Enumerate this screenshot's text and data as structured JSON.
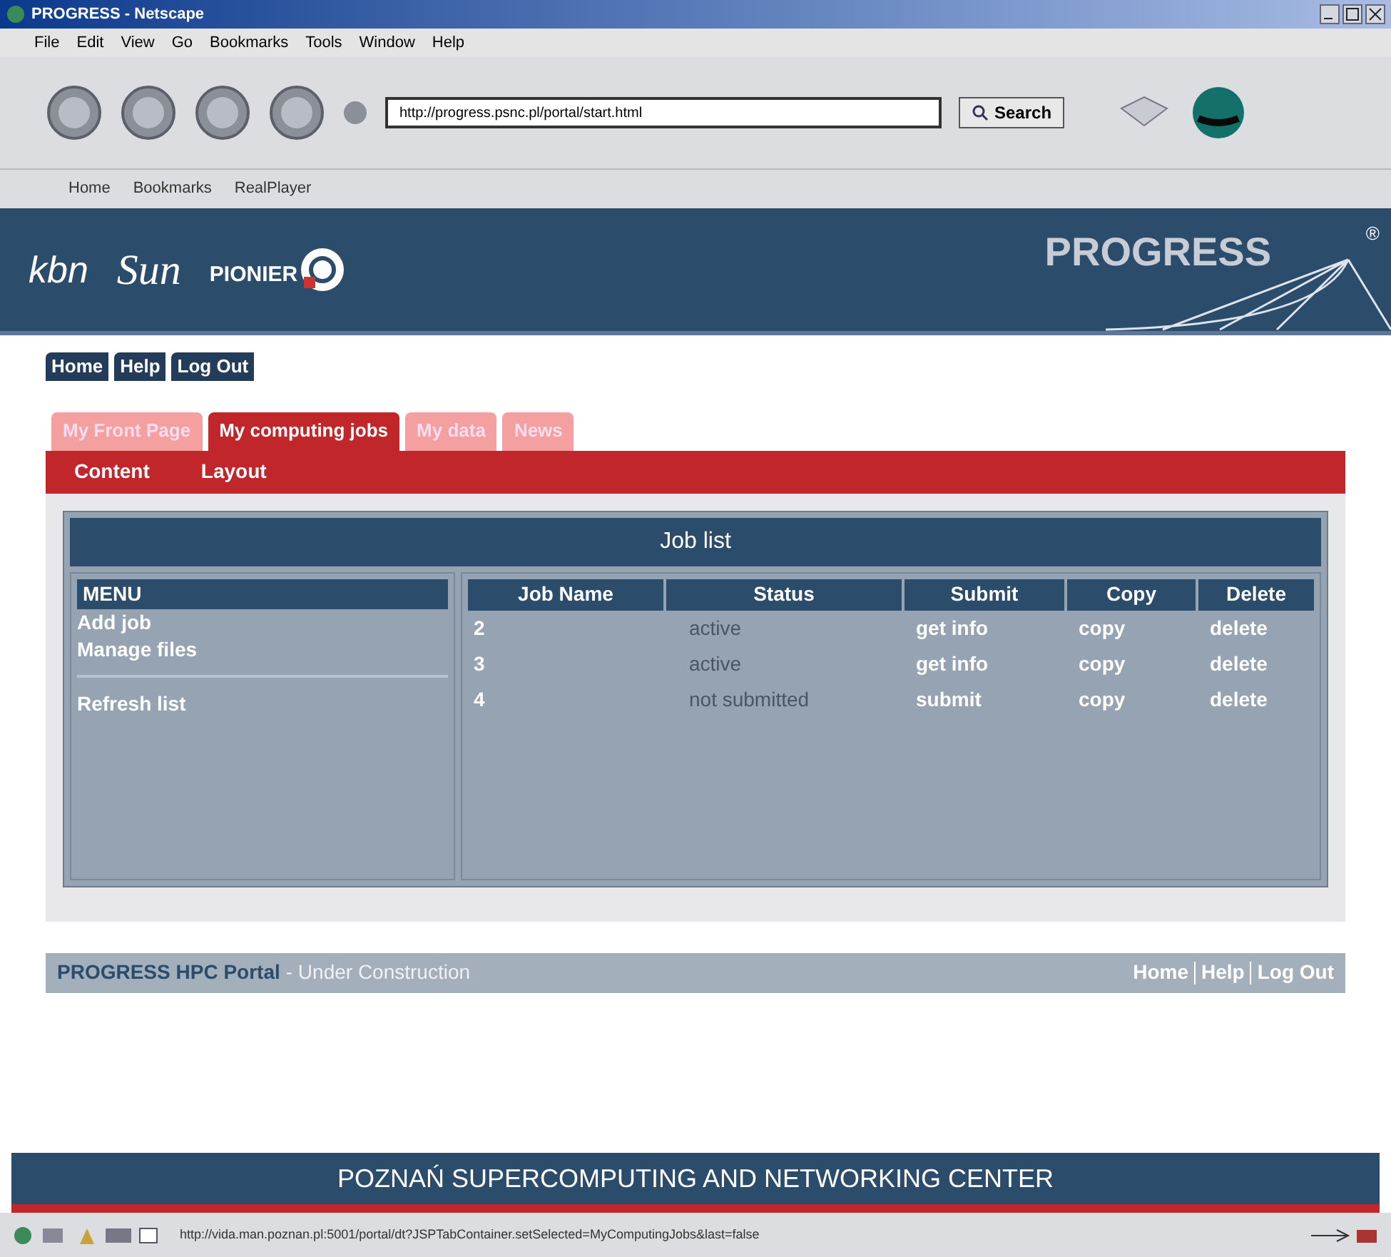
{
  "window": {
    "title": "PROGRESS - Netscape"
  },
  "menu_bar": [
    "File",
    "Edit",
    "View",
    "Go",
    "Bookmarks",
    "Tools",
    "Window",
    "Help"
  ],
  "address": {
    "value": "http://progress.psnc.pl/portal/start.html"
  },
  "search_button": "Search",
  "personal_bar": [
    "Home",
    "Bookmarks",
    "RealPlayer"
  ],
  "banner": {
    "logos": [
      "kbn",
      "Sun",
      "PIONIER"
    ],
    "brand": "PROGRESS",
    "registered": "®"
  },
  "top_links": [
    "Home",
    "Help",
    "Log Out"
  ],
  "tabs": [
    {
      "label": "My Front Page",
      "selected": false
    },
    {
      "label": "My computing jobs",
      "selected": true
    },
    {
      "label": "My data",
      "selected": false
    },
    {
      "label": "News",
      "selected": false
    }
  ],
  "subtabs": [
    "Content",
    "Layout"
  ],
  "panel": {
    "title": "Job list",
    "menu": {
      "title": "MENU",
      "items": [
        "Add job",
        "Manage files"
      ],
      "after_divider": [
        "Refresh list"
      ]
    },
    "table": {
      "columns": [
        "Job Name",
        "Status",
        "Submit",
        "Copy",
        "Delete"
      ],
      "rows": [
        [
          "2",
          "active",
          "get info",
          "copy",
          "delete"
        ],
        [
          "3",
          "active",
          "get info",
          "copy",
          "delete"
        ],
        [
          "4",
          "not submitted",
          "submit",
          "copy",
          "delete"
        ]
      ]
    }
  },
  "footer": {
    "title": "PROGRESS HPC Portal",
    "note": "- Under Construction",
    "links": [
      "Home",
      "Help",
      "Log Out"
    ]
  },
  "bottom_band": "POZNAŃ SUPERCOMPUTING AND NETWORKING CENTER",
  "status_bar": {
    "url": "http://vida.man.poznan.pl:5001/portal/dt?JSPTabContainer.setSelected=MyComputingJobs&last=false"
  }
}
